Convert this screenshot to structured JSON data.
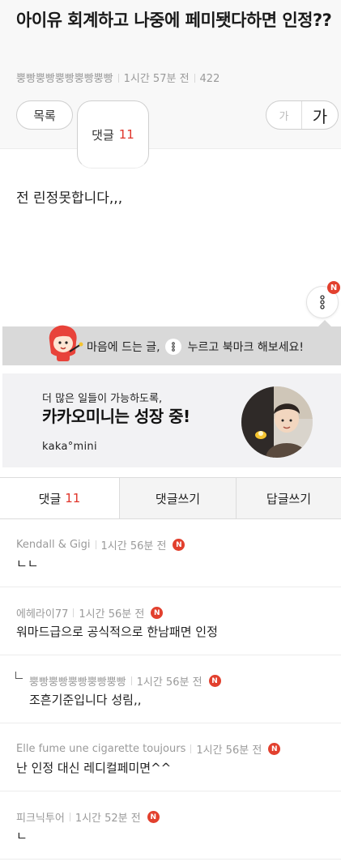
{
  "post": {
    "title": "아이유 회계하고 나중에 페미됏다하면 인정??",
    "author": "뿡빵뿡빵뿡빵뿡빵뿡빵",
    "time": "1시간 57분 전",
    "views": "422",
    "body": "전 린정못합니다,,,"
  },
  "toolbar": {
    "list_label": "목록",
    "comment_label": "댓글",
    "comment_count": "11",
    "font_small": "가",
    "font_large": "가"
  },
  "more_button": {
    "badge": "N"
  },
  "bookmark_bar": {
    "text_before": "마음에 드는 글,",
    "text_after": "누르고 북마크 해보세요!"
  },
  "ad": {
    "small_text": "더 많은 일들이 가능하도록,",
    "big_text": "카카오미니는 성장 중!",
    "logo_text": "kaka°mini"
  },
  "tabs": [
    {
      "label": "댓글",
      "count": "11"
    },
    {
      "label": "댓글쓰기"
    },
    {
      "label": "답글쓰기"
    }
  ],
  "comments": [
    {
      "author": "Kendall & Gigi",
      "time": "1시간 56분 전",
      "badge": "N",
      "text": "ㄴㄴ",
      "reply": false
    },
    {
      "author": "에헤라이77",
      "time": "1시간 56분 전",
      "badge": "N",
      "text": "워마드급으로 공식적으로 한남패면 인정",
      "reply": false
    },
    {
      "author": "뿡빵뿡빵뿡빵뿡빵뿡빵",
      "time": "1시간 56분 전",
      "badge": "N",
      "text": "조흔기준입니다 성림,,",
      "reply": true
    },
    {
      "author": "Elle fume une cigarette toujours",
      "time": "1시간 56분 전",
      "badge": "N",
      "text": "난 인정 대신 레디컬페미면^^",
      "reply": false
    },
    {
      "author": "피크닉투어",
      "time": "1시간 52분 전",
      "badge": "N",
      "text": "ㄴ",
      "reply": false
    }
  ],
  "colors": {
    "accent_red": "#e0352b",
    "badge_red": "#e2402e",
    "mascot_red": "#e8433a"
  },
  "icons": [
    "more-vertical-icon",
    "mascot-icon",
    "reply-arrow-icon"
  ]
}
